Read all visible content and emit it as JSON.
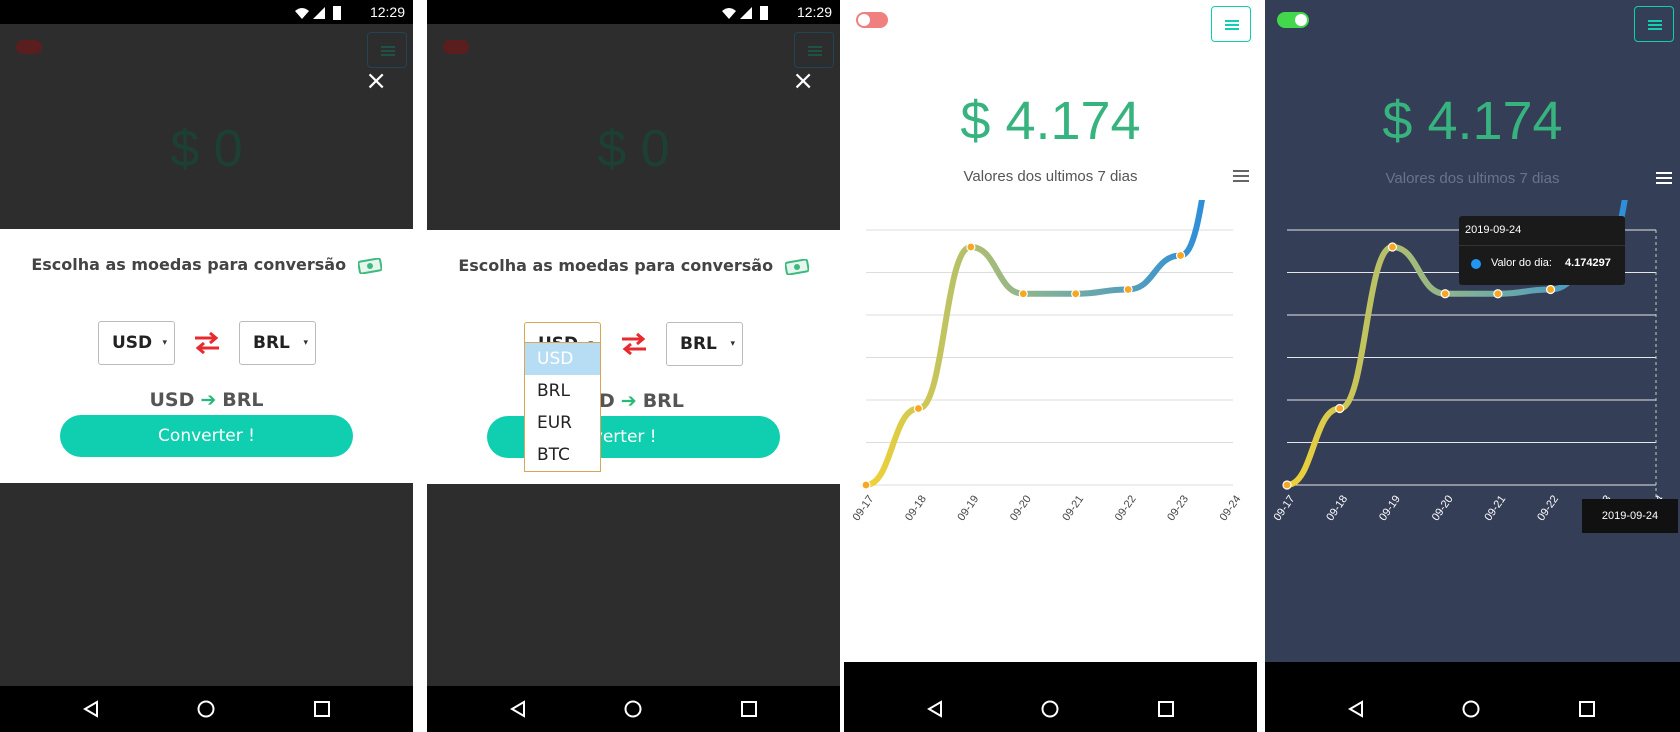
{
  "status_time": "12:29",
  "modal": {
    "title": "Escolha as moedas para conversão",
    "from_currency": "USD",
    "to_currency": "BRL",
    "pair_from": "USD",
    "pair_to": "BRL",
    "convert_label": "Converter !",
    "close_glyph": "×",
    "arrow_glyph": "➔",
    "caret_glyph": "▾"
  },
  "background_price": "$ 0",
  "dropdown_options": [
    "USD",
    "BRL",
    "EUR",
    "BTC"
  ],
  "dropdown_selected": "USD",
  "partial_texts": {
    "pair_from_partial": "D",
    "convert_partial": "nverter !"
  },
  "chart_screen": {
    "price": "$ 4.174",
    "subtitle": "Valores dos ultimos 7 dias"
  },
  "tooltip": {
    "date": "2019-09-24",
    "label": "Valor do dia:",
    "value": "4.174297",
    "x_label": "2019-09-24"
  },
  "colors": {
    "accent": "#0fcfb0",
    "price_green": "#36b37e",
    "swap_red": "#e8292e",
    "dark_bg": "#343e57",
    "toggle_off": "#f08080",
    "toggle_on": "#43d84b",
    "gradient_start": "#f2d234",
    "gradient_end": "#1e88e5",
    "point_fill": "#f7a721"
  },
  "icons": [
    "wifi-icon",
    "signal-icon",
    "battery-icon",
    "close-icon",
    "money-icon",
    "swap-icon",
    "arrow-right-icon",
    "menu-icon",
    "back-icon",
    "home-icon",
    "recents-icon"
  ],
  "chart_data": {
    "type": "line",
    "title": "Valores dos ultimos 7 dias",
    "categories": [
      "09-17",
      "09-18",
      "09-19",
      "09-20",
      "09-21",
      "09-22",
      "09-23",
      "09-24"
    ],
    "series": [
      {
        "name": "Valor do dia",
        "values": [
          4.08,
          4.098,
          4.136,
          4.125,
          4.125,
          4.126,
          4.134,
          4.174297
        ]
      }
    ],
    "ylim": [
      4.08,
      4.14
    ],
    "grid": true,
    "smooth": true,
    "xlabel": "",
    "ylabel": ""
  }
}
